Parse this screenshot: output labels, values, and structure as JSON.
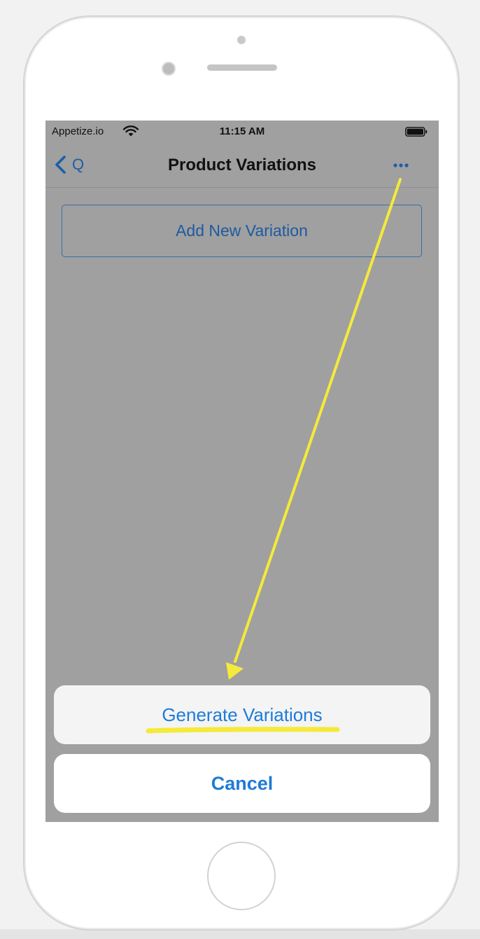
{
  "status_bar": {
    "carrier": "Appetize.io",
    "time": "11:15 AM",
    "wifi_icon": "wifi-icon",
    "battery_icon": "battery-icon"
  },
  "nav_bar": {
    "back_label": "Q",
    "back_icon": "chevron-left-icon",
    "title": "Product Variations",
    "more_icon": "ellipsis-icon"
  },
  "content": {
    "add_variation_label": "Add New Variation"
  },
  "action_sheet": {
    "option_label": "Generate Variations",
    "cancel_label": "Cancel"
  },
  "colors": {
    "accent": "#1e7bd8",
    "dim_background": "#a0a0a0",
    "annotation": "#f4ea3a"
  }
}
